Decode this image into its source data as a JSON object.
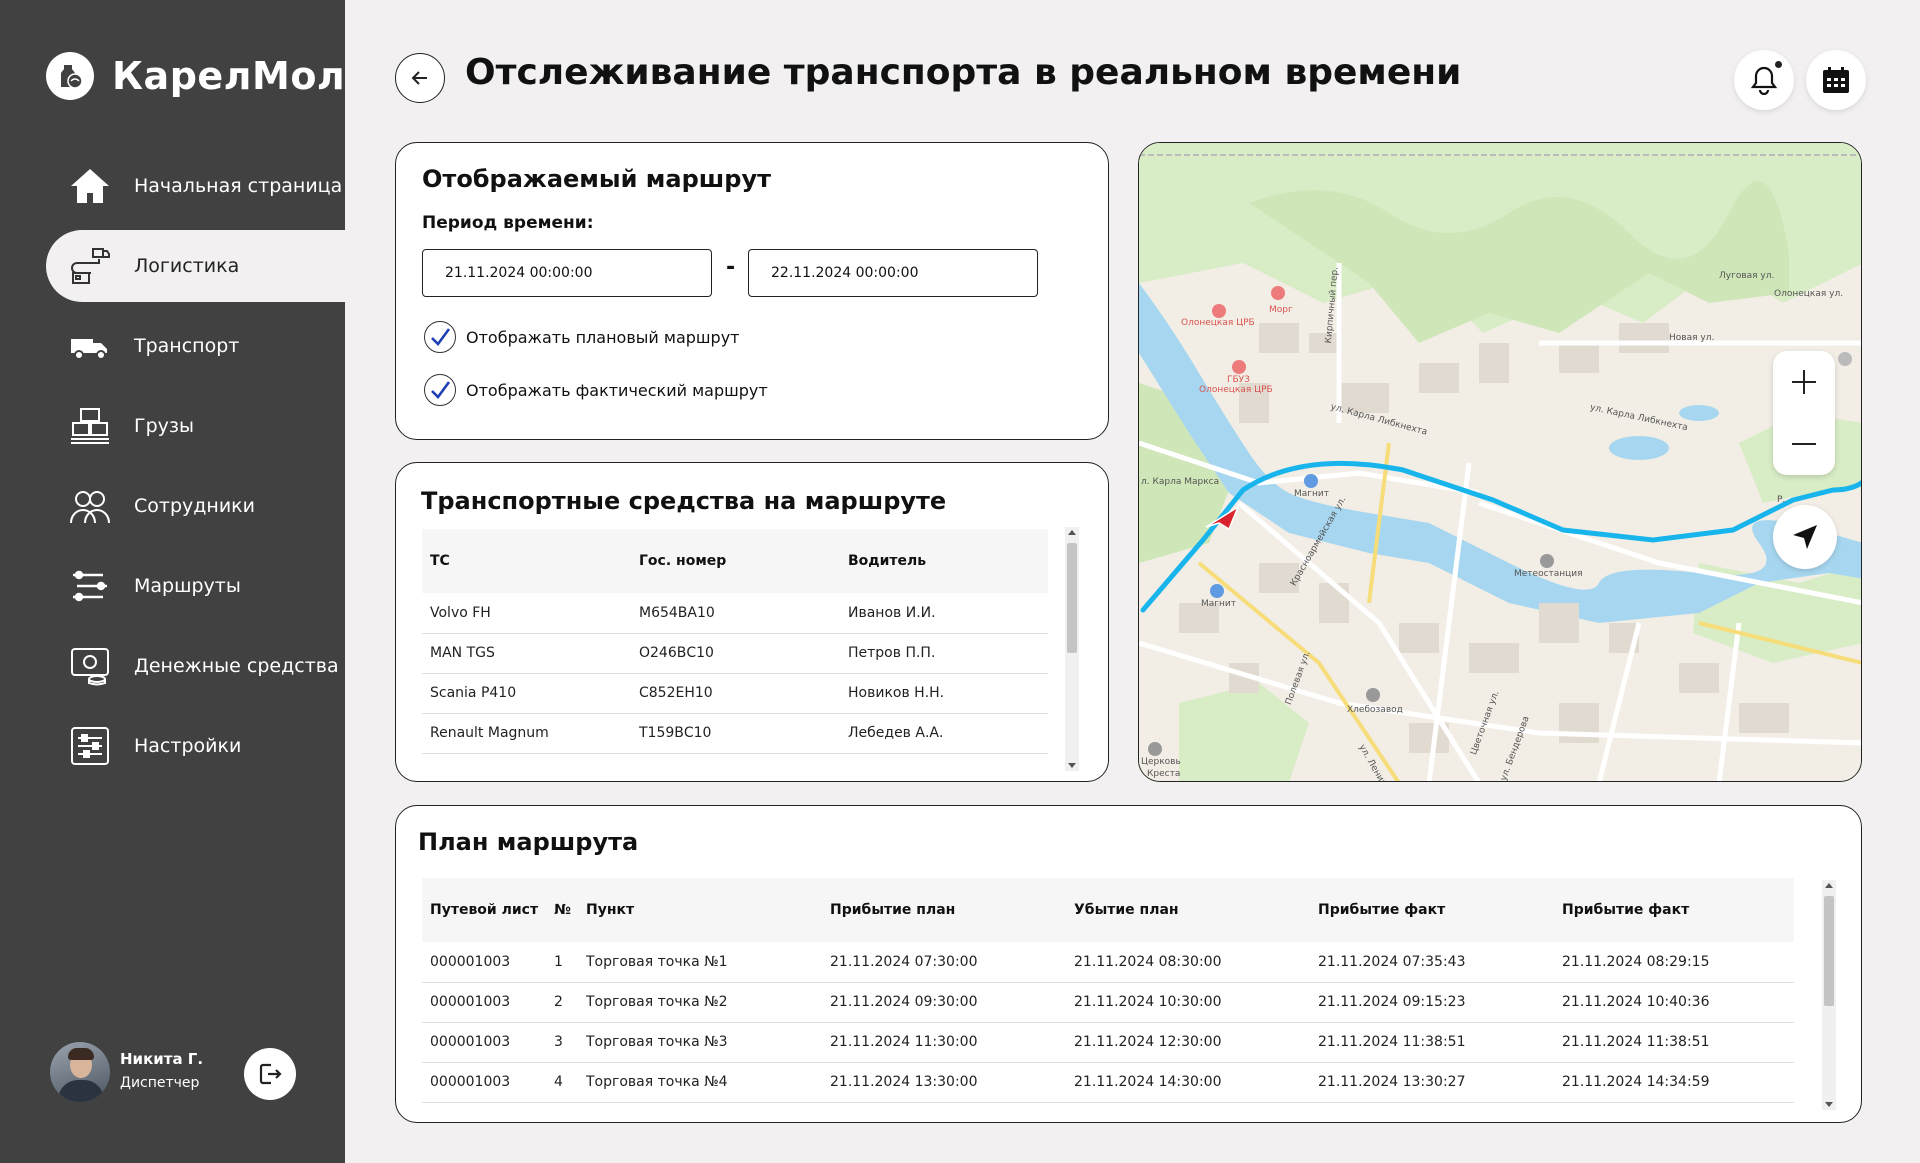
{
  "app": {
    "name": "КарелМол"
  },
  "sidebar": {
    "items": [
      {
        "label": "Начальная страница",
        "icon": "home-icon"
      },
      {
        "label": "Логистика",
        "icon": "logistics-icon",
        "active": true
      },
      {
        "label": "Транспорт",
        "icon": "truck-icon"
      },
      {
        "label": "Грузы",
        "icon": "cargo-icon"
      },
      {
        "label": "Сотрудники",
        "icon": "employees-icon"
      },
      {
        "label": "Маршруты",
        "icon": "routes-icon"
      },
      {
        "label": "Денежные средства",
        "icon": "money-icon"
      },
      {
        "label": "Настройки",
        "icon": "settings-icon"
      }
    ]
  },
  "user": {
    "name": "Никита Г.",
    "role": "Диспетчер"
  },
  "header": {
    "title": "Отслеживание транспорта в реальном времени"
  },
  "route_card": {
    "title": "Отображаемый маршрут",
    "period_label": "Период времени:",
    "date_from": "21.11.2024 00:00:00",
    "date_to": "22.11.2024 00:00:00",
    "separator": "-",
    "show_planned": {
      "label": "Отображать плановый маршрут",
      "checked": true
    },
    "show_actual": {
      "label": "Отображать фактический маршрут",
      "checked": true
    }
  },
  "vehicles": {
    "title": "Транспортные средства на маршруте",
    "columns": [
      "ТС",
      "Гос. номер",
      "Водитель"
    ],
    "rows": [
      [
        "Volvo FH",
        "М654ВА10",
        "Иванов И.И."
      ],
      [
        "MAN TGS",
        "О246ВС10",
        "Петров П.П."
      ],
      [
        "Scania P410",
        "С852ЕН10",
        "Новиков Н.Н."
      ],
      [
        "Renault Magnum",
        "Т159ВС10",
        "Лебедев А.А."
      ]
    ]
  },
  "plan": {
    "title": "План маршрута",
    "columns": [
      "Путевой лист",
      "№",
      "Пункт",
      "Прибытие план",
      "Убытие план",
      "Прибытие факт",
      "Прибытие факт"
    ],
    "rows": [
      [
        "000001003",
        "1",
        "Торговая точка №1",
        "21.11.2024 07:30:00",
        "21.11.2024 08:30:00",
        "21.11.2024 07:35:43",
        "21.11.2024 08:29:15"
      ],
      [
        "000001003",
        "2",
        "Торговая точка №2",
        "21.11.2024 09:30:00",
        "21.11.2024 10:30:00",
        "21.11.2024 09:15:23",
        "21.11.2024 10:40:36"
      ],
      [
        "000001003",
        "3",
        "Торговая точка №3",
        "21.11.2024 11:30:00",
        "21.11.2024 12:30:00",
        "21.11.2024 11:38:51",
        "21.11.2024 11:38:51"
      ],
      [
        "000001003",
        "4",
        "Торговая точка №4",
        "21.11.2024 13:30:00",
        "21.11.2024 14:30:00",
        "21.11.2024 13:30:27",
        "21.11.2024 14:34:59"
      ]
    ]
  },
  "map": {
    "labels": {
      "crb1": "Олонецкая ЦРБ",
      "morg": "Морг",
      "gbuz": "ГБУЗ",
      "crb2": "Олонецкая ЦРБ",
      "kirpich": "Кирпичный пер.",
      "karla_l1": "ул. Карла Либкнехта",
      "karla_l2": "ул. Карла Либкнехта",
      "karla_m": "л. Карла Маркса",
      "magnit1": "Магнит",
      "magnit2": "Магнит",
      "krasnoarm": "Красноармейская ул.",
      "lugovaya": "Луговая ул.",
      "olonets": "Олонецкая ул.",
      "novaya": "Новая ул.",
      "meteo": "Метеостанция",
      "polevaya": "Полевая ул.",
      "hlebo": "Хлебозавод",
      "lenina": "ул. Ленина",
      "cvetoch": "Цветочная ул.",
      "bend": "ул. Бендерова",
      "church": "Церковь",
      "kresta": "Креста",
      "river": "Р."
    },
    "route_color": "#18b4ec",
    "marker_color": "#d9232e"
  }
}
